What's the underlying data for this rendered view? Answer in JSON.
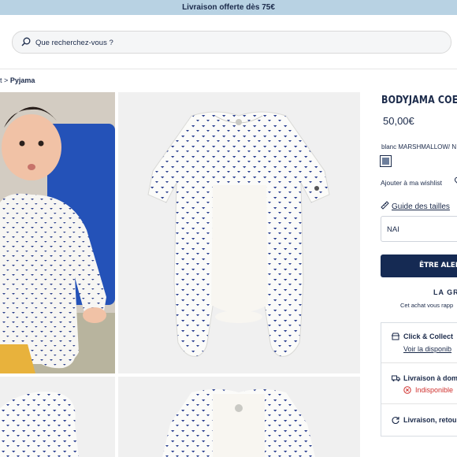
{
  "promo_bar": {
    "text": "Livraison offerte dès 75€"
  },
  "search": {
    "placeholder": "Que recherchez-vous ?"
  },
  "breadcrumb": {
    "prev": "t",
    "separator": ">",
    "current": "Pyjama"
  },
  "product": {
    "title": "BODYJAMA COE",
    "price": "50,00€",
    "color_label": "blanc MARSHMALLOW/ N",
    "wishlist": "Ajouter à ma wishlist",
    "size_guide": "Guide des tailles",
    "size_value": "NAI",
    "alert_button": "ÊTRE ALERTÉ",
    "promo_heading": "LA GR",
    "promo_note": "Cet achat vous rapp"
  },
  "delivery": {
    "click_collect_title": "Click & Collect",
    "click_collect_link": "Voir la disponib",
    "home_title": "Livraison à dom",
    "home_status": "Indisponible",
    "returns_title": "Livraison, retou"
  },
  "colors": {
    "navy": "#1b2a4a",
    "promo": "#b8d2e3",
    "button": "#152a53",
    "error": "#d0322f"
  },
  "icons": [
    "search-icon",
    "heart-icon",
    "ruler-icon",
    "store-icon",
    "truck-icon",
    "error-icon",
    "return-icon"
  ]
}
